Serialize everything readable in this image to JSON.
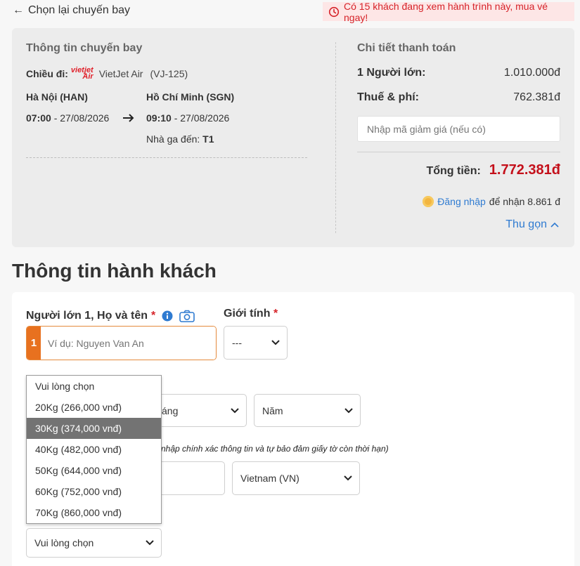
{
  "header": {
    "back_label": "Chọn lại chuyến bay",
    "alert_text": "Có 15 khách đang xem hành trình này, mua vé ngay!"
  },
  "flight": {
    "section_title": "Thông tin chuyến bay",
    "direction_label": "Chiều đi:",
    "airline_logo_text": "vietjet Air",
    "airline_name": "VietJet Air",
    "flight_code": "(VJ-125)",
    "origin": "Hà Nội (HAN)",
    "depart_time": "07:00",
    "depart_date": " - 27/08/2026",
    "destination": "Hồ Chí Minh (SGN)",
    "arrive_time": "09:10",
    "arrive_date": " - 27/08/2026",
    "terminal_label": "Nhà ga đến: ",
    "terminal_value": "T1"
  },
  "payment": {
    "section_title": "Chi tiết thanh toán",
    "adult_label": "1 Người lớn:",
    "adult_value": "1.010.000đ",
    "tax_label": "Thuế & phí:",
    "tax_value": "762.381đ",
    "promo_placeholder": "Nhập mã giảm giá (nếu có)",
    "total_label": "Tổng tiền:",
    "total_value": "1.772.381đ",
    "login_link": "Đăng nhập",
    "login_rest": " để nhận 8.861 đ",
    "collapse_label": "Thu gọn"
  },
  "passengers": {
    "heading": "Thông tin hành khách",
    "name_label": "Người lớn 1, Họ và tên",
    "required_mark": "*",
    "index": "1",
    "name_placeholder": "Ví dụ: Nguyen Van An",
    "gender_label": "Giới tính",
    "gender_value": "---",
    "month_value": "áng",
    "year_value": "Năm",
    "note": "nhập chính xác thông tin và tự bảo đảm giấy tờ còn thời hạn)",
    "nationality_value": "Vietnam (VN)",
    "baggage_value": "Vui lòng chọn"
  },
  "baggage_dropdown": {
    "options": [
      "Vui lòng chọn",
      "20Kg (266,000 vnđ)",
      "30Kg (374,000 vnđ)",
      "40Kg (482,000 vnđ)",
      "50Kg (644,000 vnđ)",
      "60Kg (752,000 vnđ)",
      "70Kg (860,000 vnđ)"
    ],
    "highlighted_index": 2
  },
  "colors": {
    "accent_orange": "#e8711f",
    "price_red": "#c4101b",
    "link_blue": "#2f7bd1"
  }
}
